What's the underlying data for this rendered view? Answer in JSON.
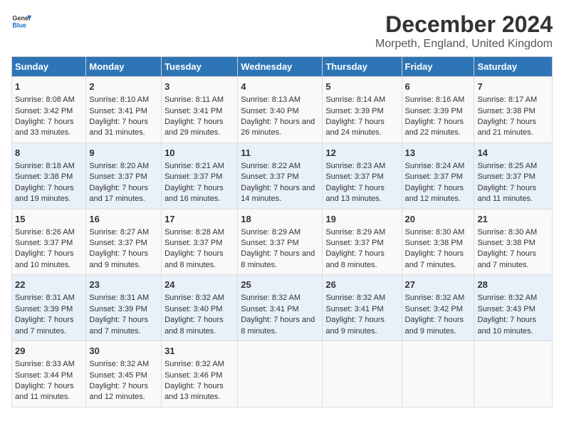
{
  "header": {
    "logo_line1": "General",
    "logo_line2": "Blue",
    "title": "December 2024",
    "subtitle": "Morpeth, England, United Kingdom"
  },
  "columns": [
    "Sunday",
    "Monday",
    "Tuesday",
    "Wednesday",
    "Thursday",
    "Friday",
    "Saturday"
  ],
  "weeks": [
    [
      {
        "day": "1",
        "sunrise": "Sunrise: 8:08 AM",
        "sunset": "Sunset: 3:42 PM",
        "daylight": "Daylight: 7 hours and 33 minutes."
      },
      {
        "day": "2",
        "sunrise": "Sunrise: 8:10 AM",
        "sunset": "Sunset: 3:41 PM",
        "daylight": "Daylight: 7 hours and 31 minutes."
      },
      {
        "day": "3",
        "sunrise": "Sunrise: 8:11 AM",
        "sunset": "Sunset: 3:41 PM",
        "daylight": "Daylight: 7 hours and 29 minutes."
      },
      {
        "day": "4",
        "sunrise": "Sunrise: 8:13 AM",
        "sunset": "Sunset: 3:40 PM",
        "daylight": "Daylight: 7 hours and 26 minutes."
      },
      {
        "day": "5",
        "sunrise": "Sunrise: 8:14 AM",
        "sunset": "Sunset: 3:39 PM",
        "daylight": "Daylight: 7 hours and 24 minutes."
      },
      {
        "day": "6",
        "sunrise": "Sunrise: 8:16 AM",
        "sunset": "Sunset: 3:39 PM",
        "daylight": "Daylight: 7 hours and 22 minutes."
      },
      {
        "day": "7",
        "sunrise": "Sunrise: 8:17 AM",
        "sunset": "Sunset: 3:38 PM",
        "daylight": "Daylight: 7 hours and 21 minutes."
      }
    ],
    [
      {
        "day": "8",
        "sunrise": "Sunrise: 8:18 AM",
        "sunset": "Sunset: 3:38 PM",
        "daylight": "Daylight: 7 hours and 19 minutes."
      },
      {
        "day": "9",
        "sunrise": "Sunrise: 8:20 AM",
        "sunset": "Sunset: 3:37 PM",
        "daylight": "Daylight: 7 hours and 17 minutes."
      },
      {
        "day": "10",
        "sunrise": "Sunrise: 8:21 AM",
        "sunset": "Sunset: 3:37 PM",
        "daylight": "Daylight: 7 hours and 16 minutes."
      },
      {
        "day": "11",
        "sunrise": "Sunrise: 8:22 AM",
        "sunset": "Sunset: 3:37 PM",
        "daylight": "Daylight: 7 hours and 14 minutes."
      },
      {
        "day": "12",
        "sunrise": "Sunrise: 8:23 AM",
        "sunset": "Sunset: 3:37 PM",
        "daylight": "Daylight: 7 hours and 13 minutes."
      },
      {
        "day": "13",
        "sunrise": "Sunrise: 8:24 AM",
        "sunset": "Sunset: 3:37 PM",
        "daylight": "Daylight: 7 hours and 12 minutes."
      },
      {
        "day": "14",
        "sunrise": "Sunrise: 8:25 AM",
        "sunset": "Sunset: 3:37 PM",
        "daylight": "Daylight: 7 hours and 11 minutes."
      }
    ],
    [
      {
        "day": "15",
        "sunrise": "Sunrise: 8:26 AM",
        "sunset": "Sunset: 3:37 PM",
        "daylight": "Daylight: 7 hours and 10 minutes."
      },
      {
        "day": "16",
        "sunrise": "Sunrise: 8:27 AM",
        "sunset": "Sunset: 3:37 PM",
        "daylight": "Daylight: 7 hours and 9 minutes."
      },
      {
        "day": "17",
        "sunrise": "Sunrise: 8:28 AM",
        "sunset": "Sunset: 3:37 PM",
        "daylight": "Daylight: 7 hours and 8 minutes."
      },
      {
        "day": "18",
        "sunrise": "Sunrise: 8:29 AM",
        "sunset": "Sunset: 3:37 PM",
        "daylight": "Daylight: 7 hours and 8 minutes."
      },
      {
        "day": "19",
        "sunrise": "Sunrise: 8:29 AM",
        "sunset": "Sunset: 3:37 PM",
        "daylight": "Daylight: 7 hours and 8 minutes."
      },
      {
        "day": "20",
        "sunrise": "Sunrise: 8:30 AM",
        "sunset": "Sunset: 3:38 PM",
        "daylight": "Daylight: 7 hours and 7 minutes."
      },
      {
        "day": "21",
        "sunrise": "Sunrise: 8:30 AM",
        "sunset": "Sunset: 3:38 PM",
        "daylight": "Daylight: 7 hours and 7 minutes."
      }
    ],
    [
      {
        "day": "22",
        "sunrise": "Sunrise: 8:31 AM",
        "sunset": "Sunset: 3:39 PM",
        "daylight": "Daylight: 7 hours and 7 minutes."
      },
      {
        "day": "23",
        "sunrise": "Sunrise: 8:31 AM",
        "sunset": "Sunset: 3:39 PM",
        "daylight": "Daylight: 7 hours and 7 minutes."
      },
      {
        "day": "24",
        "sunrise": "Sunrise: 8:32 AM",
        "sunset": "Sunset: 3:40 PM",
        "daylight": "Daylight: 7 hours and 8 minutes."
      },
      {
        "day": "25",
        "sunrise": "Sunrise: 8:32 AM",
        "sunset": "Sunset: 3:41 PM",
        "daylight": "Daylight: 7 hours and 8 minutes."
      },
      {
        "day": "26",
        "sunrise": "Sunrise: 8:32 AM",
        "sunset": "Sunset: 3:41 PM",
        "daylight": "Daylight: 7 hours and 9 minutes."
      },
      {
        "day": "27",
        "sunrise": "Sunrise: 8:32 AM",
        "sunset": "Sunset: 3:42 PM",
        "daylight": "Daylight: 7 hours and 9 minutes."
      },
      {
        "day": "28",
        "sunrise": "Sunrise: 8:32 AM",
        "sunset": "Sunset: 3:43 PM",
        "daylight": "Daylight: 7 hours and 10 minutes."
      }
    ],
    [
      {
        "day": "29",
        "sunrise": "Sunrise: 8:33 AM",
        "sunset": "Sunset: 3:44 PM",
        "daylight": "Daylight: 7 hours and 11 minutes."
      },
      {
        "day": "30",
        "sunrise": "Sunrise: 8:32 AM",
        "sunset": "Sunset: 3:45 PM",
        "daylight": "Daylight: 7 hours and 12 minutes."
      },
      {
        "day": "31",
        "sunrise": "Sunrise: 8:32 AM",
        "sunset": "Sunset: 3:46 PM",
        "daylight": "Daylight: 7 hours and 13 minutes."
      },
      null,
      null,
      null,
      null
    ]
  ]
}
